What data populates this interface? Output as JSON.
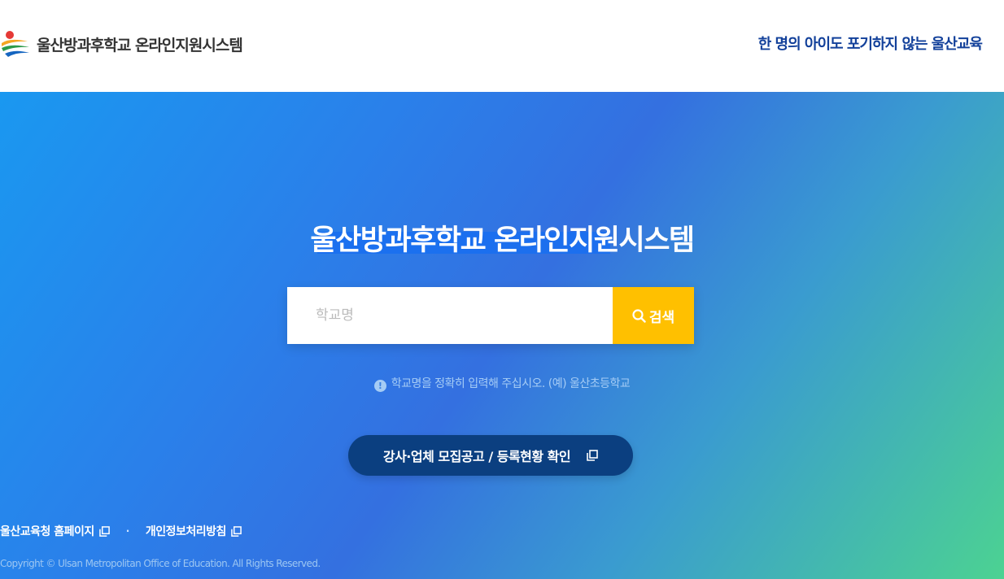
{
  "header": {
    "logo_title": "울산방과후학교 온라인지원시스템",
    "slogan": "한 명의 아이도 포기하지 않는 울산교육"
  },
  "hero": {
    "title": "울산방과후학교 온라인지원시스템",
    "search": {
      "placeholder": "학교명",
      "value": "",
      "button_label": "검색"
    },
    "hint": "학교명을 정확히 입력해 주십시오. (예) 울산초등학교",
    "recruit_button_label": "강사·업체 모집공고 / 등록현황 확인"
  },
  "footer": {
    "links": [
      {
        "label": "울산교육청 홈페이지"
      },
      {
        "label": "개인정보처리방침"
      }
    ],
    "copyright": "Copyright © Ulsan Metropolitan Office of Education. All Rights Reserved."
  },
  "colors": {
    "accent_yellow": "#ffc000",
    "recruit_button": "#0b3f80",
    "gradient_start": "#1a98f0",
    "gradient_end": "#4cd292"
  }
}
